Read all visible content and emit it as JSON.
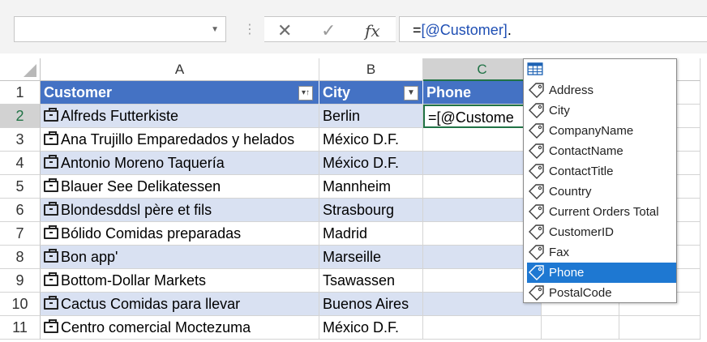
{
  "formula_bar": {
    "namebox_value": "",
    "cancel_icon": "x-icon",
    "enter_icon": "checkmark-icon",
    "function_icon": "fx-icon",
    "formula_prefix": "=",
    "formula_ref": "[@Customer]",
    "formula_suffix": "."
  },
  "columns": [
    {
      "letter": "A"
    },
    {
      "letter": "B"
    },
    {
      "letter": "C"
    }
  ],
  "header_row": {
    "number": "1",
    "customer": "Customer",
    "city": "City",
    "phone": "Phone"
  },
  "rows": [
    {
      "n": "2",
      "customer": "Alfreds Futterkiste",
      "city": "Berlin",
      "phone": "=[@Custome"
    },
    {
      "n": "3",
      "customer": "Ana Trujillo Emparedados y helados",
      "city": "México D.F.",
      "phone": ""
    },
    {
      "n": "4",
      "customer": "Antonio Moreno Taquería",
      "city": "México D.F.",
      "phone": ""
    },
    {
      "n": "5",
      "customer": "Blauer See Delikatessen",
      "city": "Mannheim",
      "phone": ""
    },
    {
      "n": "6",
      "customer": "Blondesddsl père et fils",
      "city": "Strasbourg",
      "phone": ""
    },
    {
      "n": "7",
      "customer": "Bólido Comidas preparadas",
      "city": "Madrid",
      "phone": ""
    },
    {
      "n": "8",
      "customer": "Bon app'",
      "city": "Marseille",
      "phone": ""
    },
    {
      "n": "9",
      "customer": "Bottom-Dollar Markets",
      "city": "Tsawassen",
      "phone": ""
    },
    {
      "n": "10",
      "customer": "Cactus Comidas para llevar",
      "city": "Buenos Aires",
      "phone": ""
    },
    {
      "n": "11",
      "customer": "Centro comercial Moctezuma",
      "city": "México D.F.",
      "phone": ""
    }
  ],
  "autocomplete": {
    "header_icon": "table-icon",
    "items": [
      {
        "label": "Address",
        "selected": false
      },
      {
        "label": "City",
        "selected": false
      },
      {
        "label": "CompanyName",
        "selected": false
      },
      {
        "label": "ContactName",
        "selected": false
      },
      {
        "label": "ContactTitle",
        "selected": false
      },
      {
        "label": "Country",
        "selected": false
      },
      {
        "label": "Current Orders Total",
        "selected": false
      },
      {
        "label": "CustomerID",
        "selected": false
      },
      {
        "label": "Fax",
        "selected": false
      },
      {
        "label": "Phone",
        "selected": true
      },
      {
        "label": "PostalCode",
        "selected": false
      }
    ]
  },
  "colors": {
    "table_header": "#4472c4",
    "band": "#d9e1f2",
    "selection": "#217346",
    "list_highlight": "#1e78d2"
  }
}
